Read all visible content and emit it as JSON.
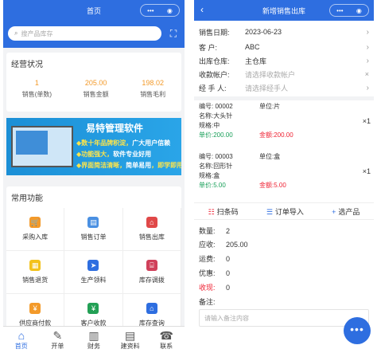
{
  "left": {
    "title": "首页",
    "capsule": {
      "more": "•••",
      "close": "◉"
    },
    "search_placeholder": "搜产品库存",
    "scan_icon": "⛶",
    "ops": {
      "title": "经营状况",
      "stats": [
        {
          "value": "1",
          "label": "销售(单数)"
        },
        {
          "value": "205.00",
          "label": "销售金额"
        },
        {
          "value": "198.02",
          "label": "销售毛利"
        }
      ]
    },
    "banner": {
      "title": "易特管理软件",
      "lines": [
        {
          "prefix": "◆",
          "a": "数十年品牌积淀",
          "b": "广大用户信赖"
        },
        {
          "prefix": "◆",
          "a": "功能强大",
          "b": "软件专业好用"
        },
        {
          "prefix": "◆",
          "a": "界面简洁清晰",
          "b": "简单易用",
          "c": "即学即用"
        }
      ]
    },
    "common": {
      "title": "常用功能",
      "items": [
        {
          "label": "采购入库",
          "icon": "🛒",
          "color": "#f39a2a"
        },
        {
          "label": "销售订单",
          "icon": "▤",
          "color": "#4a90e2"
        },
        {
          "label": "销售出库",
          "icon": "⌂",
          "color": "#e04848"
        },
        {
          "label": "销售退货",
          "icon": "▦",
          "color": "#f3c21b"
        },
        {
          "label": "生产领料",
          "icon": "➤",
          "color": "#2e6ee0"
        },
        {
          "label": "库存调拨",
          "icon": "⌸",
          "color": "#d0405a"
        },
        {
          "label": "供应商付款",
          "icon": "¥",
          "color": "#f39a2a"
        },
        {
          "label": "客户收款",
          "icon": "¥",
          "color": "#23a055"
        },
        {
          "label": "库存查询",
          "icon": "⌂",
          "color": "#2e6ee0"
        }
      ]
    },
    "tabs": [
      {
        "label": "首页",
        "icon": "⌂"
      },
      {
        "label": "开单",
        "icon": "✎"
      },
      {
        "label": "财务",
        "icon": "▥"
      },
      {
        "label": "建资料",
        "icon": "▤"
      },
      {
        "label": "联系",
        "icon": "☎"
      }
    ]
  },
  "right": {
    "title": "新增销售出库",
    "back_icon": "‹",
    "capsule": {
      "more": "•••",
      "close": "◉"
    },
    "fields": [
      {
        "key": "销售日期:",
        "value": "2023-06-23",
        "ph": false
      },
      {
        "key": "客   户:",
        "value": "ABC",
        "ph": false
      },
      {
        "key": "出库仓库:",
        "value": "主仓库",
        "ph": false
      },
      {
        "key": "收款帐户:",
        "value": "请选择收款帐户",
        "ph": true
      },
      {
        "key": "经 手 人:",
        "value": "请选择经手人",
        "ph": true
      }
    ],
    "products": [
      {
        "code_label": "编号:",
        "code": "00002",
        "unit_label": "单位:",
        "unit": "片",
        "name_label": "名称:",
        "name": "大头针",
        "spec_label": "规格:",
        "spec": "中",
        "price_label": "单价:",
        "price": "200.00",
        "amount_label": "金额:",
        "amount": "200.00",
        "qty": "×1"
      },
      {
        "code_label": "编号:",
        "code": "00003",
        "unit_label": "单位:",
        "unit": "盒",
        "name_label": "名称:",
        "name": "回形针",
        "spec_label": "规格:",
        "spec": "盒",
        "price_label": "单价:",
        "price": "5.00",
        "amount_label": "金额:",
        "amount": "5.00",
        "qty": "×1"
      }
    ],
    "actions": [
      {
        "icon": "☷",
        "label": "扫条码"
      },
      {
        "icon": "☰",
        "label": "订单导入"
      },
      {
        "icon": "+",
        "label": "选产品"
      }
    ],
    "totals": [
      {
        "key": "数量:",
        "value": "2",
        "red": false
      },
      {
        "key": "应收:",
        "value": "205.00",
        "red": false
      },
      {
        "key": "运费:",
        "value": "0",
        "red": false
      },
      {
        "key": "优惠:",
        "value": "0",
        "red": false
      },
      {
        "key": "收现:",
        "value": "0",
        "red": true
      }
    ],
    "memo_label": "备注:",
    "memo_placeholder": "请输入备注内容",
    "fab": "•••"
  }
}
